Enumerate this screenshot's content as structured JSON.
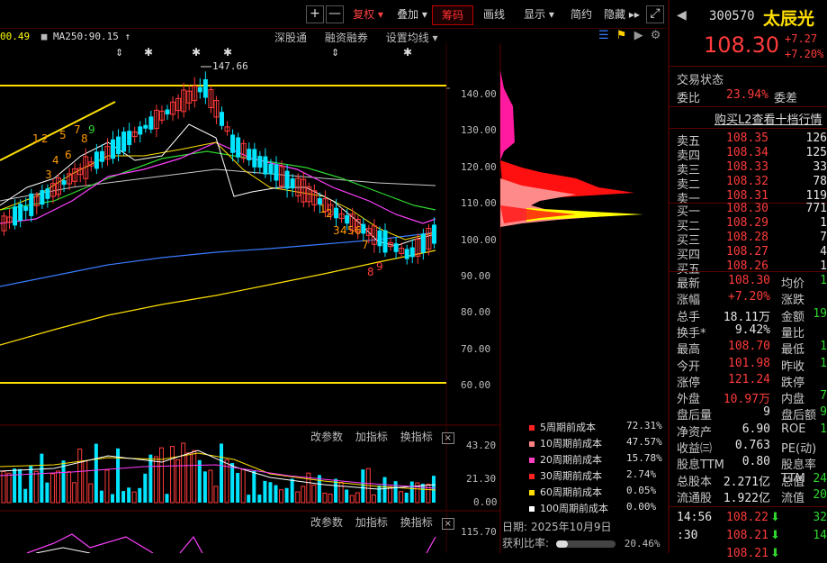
{
  "toolbar": {
    "plus_label": "+",
    "minus_label": "—",
    "buttons": [
      {
        "label": "复权 ▾"
      },
      {
        "label": "叠加 ▾"
      },
      {
        "label": "筹码"
      },
      {
        "label": "画线"
      },
      {
        "label": "显示 ▾"
      },
      {
        "label": "简约"
      },
      {
        "label": "隐藏 ▸▸"
      }
    ],
    "expand_label": "⤢"
  },
  "indicator_line": {
    "prefix": "00.49",
    "ma250": "MA250:90.15",
    "arrow": "↑",
    "links": [
      "深股通",
      "融资融券",
      "设置均线 ▾"
    ]
  },
  "price_chart": {
    "max_label": "147.66",
    "axis_labels": [
      "140.00",
      "130.00",
      "120.00",
      "110.00",
      "100.00",
      "90.00",
      "80.00",
      "70.00",
      "60.00"
    ],
    "count_labels_top": [
      "1",
      "2",
      "5",
      "7",
      "8",
      "9",
      "3",
      "4",
      "6"
    ],
    "count_labels_low": [
      "1",
      "2",
      "3",
      "4",
      "5",
      "6",
      "7",
      "8",
      "9"
    ],
    "colors": {
      "up": "#ff3b3b",
      "down": "#00e5ff",
      "ma_white": "#ffffff",
      "ma_yellow": "#ffe000",
      "ma_magenta": "#ff40ff",
      "ma_green": "#2fd62f",
      "ma_blue": "#3a7bff",
      "ma_grey": "#c8c8c8"
    }
  },
  "volume_panel": {
    "links": [
      "改参数",
      "加指标",
      "换指标"
    ],
    "close": "×",
    "axis_labels": [
      "43.20",
      "21.30",
      "0.00"
    ]
  },
  "macd_panel": {
    "links": [
      "改参数",
      "加指标",
      "换指标"
    ],
    "close": "×",
    "axis_label": "115.70"
  },
  "chip_panel": {
    "rows": [
      {
        "name": "5周期前成本",
        "value": "72.31%",
        "color": "#ff2020"
      },
      {
        "name": "10周期前成本",
        "value": "47.57%",
        "color": "#ff8080"
      },
      {
        "name": "20周期前成本",
        "value": "15.78%",
        "color": "#ff40c0"
      },
      {
        "name": "30周期前成本",
        "value": "2.74%",
        "color": "#ff2020"
      },
      {
        "name": "60周期前成本",
        "value": "0.05%",
        "color": "#ffe000"
      },
      {
        "name": "100周期前成本",
        "value": "0.00%",
        "color": "#ffffff"
      }
    ],
    "date_label": "日期:",
    "date": "2025年10月9日",
    "profit_label": "获利比率:",
    "profit_value": "20.46%",
    "profit_ratio": 0.2046
  },
  "quote": {
    "code": "300570",
    "name": "太辰光",
    "price": "108.30",
    "change": "+7.27",
    "change_pct": "+7.20%",
    "status_label": "交易状态",
    "weibi_label": "委比",
    "weibi": "23.94%",
    "weicha_label": "委差",
    "l2_link": "购买L2查看十档行情",
    "asks": [
      {
        "label": "卖五",
        "price": "108.35",
        "vol": "126"
      },
      {
        "label": "卖四",
        "price": "108.34",
        "vol": "125"
      },
      {
        "label": "卖三",
        "price": "108.33",
        "vol": "33"
      },
      {
        "label": "卖二",
        "price": "108.32",
        "vol": "78"
      },
      {
        "label": "卖一",
        "price": "108.31",
        "vol": "119"
      }
    ],
    "bids": [
      {
        "label": "买一",
        "price": "108.30",
        "vol": "771"
      },
      {
        "label": "买二",
        "price": "108.29",
        "vol": "1"
      },
      {
        "label": "买三",
        "price": "108.28",
        "vol": "7"
      },
      {
        "label": "买四",
        "price": "108.27",
        "vol": "4"
      },
      {
        "label": "买五",
        "price": "108.26",
        "vol": "1"
      }
    ],
    "stats": [
      {
        "l1": "最新",
        "v1": "108.30",
        "c1": "red",
        "l2": "均价",
        "v2": "1"
      },
      {
        "l1": "涨幅",
        "v1": "+7.20%",
        "c1": "red",
        "l2": "涨跌",
        "v2": ""
      },
      {
        "l1": "总手",
        "v1": "18.11万",
        "c1": "white",
        "l2": "金额",
        "v2": "19"
      },
      {
        "l1": "换手*",
        "v1": "9.42%",
        "c1": "white",
        "l2": "量比",
        "v2": ""
      },
      {
        "l1": "最高",
        "v1": "108.70",
        "c1": "red",
        "l2": "最低",
        "v2": "1"
      },
      {
        "l1": "今开",
        "v1": "101.98",
        "c1": "red",
        "l2": "昨收",
        "v2": "1"
      },
      {
        "l1": "涨停",
        "v1": "121.24",
        "c1": "red",
        "l2": "跌停",
        "v2": ""
      },
      {
        "l1": "外盘",
        "v1": "10.97万",
        "c1": "red",
        "l2": "内盘",
        "v2": "7"
      },
      {
        "l1": "盘后量",
        "v1": "9",
        "c1": "white",
        "l2": "盘后额",
        "v2": "9"
      },
      {
        "l1": "净资产",
        "v1": "6.90",
        "c1": "white",
        "l2": "ROE",
        "v2": "1"
      },
      {
        "l1": "收益㈢",
        "v1": "0.763",
        "c1": "white",
        "l2": "PE(动)",
        "v2": ""
      },
      {
        "l1": "股息TTM",
        "v1": "0.80",
        "c1": "white",
        "l2": "股息率TTM",
        "v2": ""
      },
      {
        "l1": "总股本",
        "v1": "2.271亿",
        "c1": "white",
        "l2": "总值",
        "v2": "24"
      },
      {
        "l1": "流通股",
        "v1": "1.922亿",
        "c1": "white",
        "l2": "流值",
        "v2": "20"
      }
    ],
    "ticks": [
      {
        "time": "14:56",
        "price": "108.22",
        "vol": "32"
      },
      {
        "time": ":30",
        "price": "108.21",
        "vol": "14"
      },
      {
        "time": "",
        "price": "108.21",
        "vol": ""
      }
    ]
  }
}
